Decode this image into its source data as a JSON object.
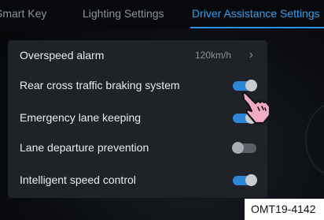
{
  "tabs": [
    {
      "label": "Smart Key",
      "active": false
    },
    {
      "label": "Lighting Settings",
      "active": false
    },
    {
      "label": "Driver Assistance Settings",
      "active": true
    }
  ],
  "settings": [
    {
      "label": "Overspeed alarm",
      "value": "120km/h",
      "type": "submenu"
    },
    {
      "label": "Rear cross traffic braking system",
      "type": "toggle",
      "on": true
    },
    {
      "label": "Emergency lane keeping",
      "type": "toggle",
      "on": true
    },
    {
      "label": "Lane departure prevention",
      "type": "toggle",
      "on": false
    },
    {
      "label": "Intelligent speed control",
      "type": "toggle",
      "on": true
    }
  ],
  "figure_code": "OMT19-4142",
  "colors": {
    "accent": "#2e86d6",
    "active_tab": "#33a0f0",
    "panel": "#1f2328",
    "cursor_fill": "#f2a9c4"
  },
  "icons": {
    "submenu": "chevron-right-icon",
    "pointer": "hand-pointer-icon"
  }
}
